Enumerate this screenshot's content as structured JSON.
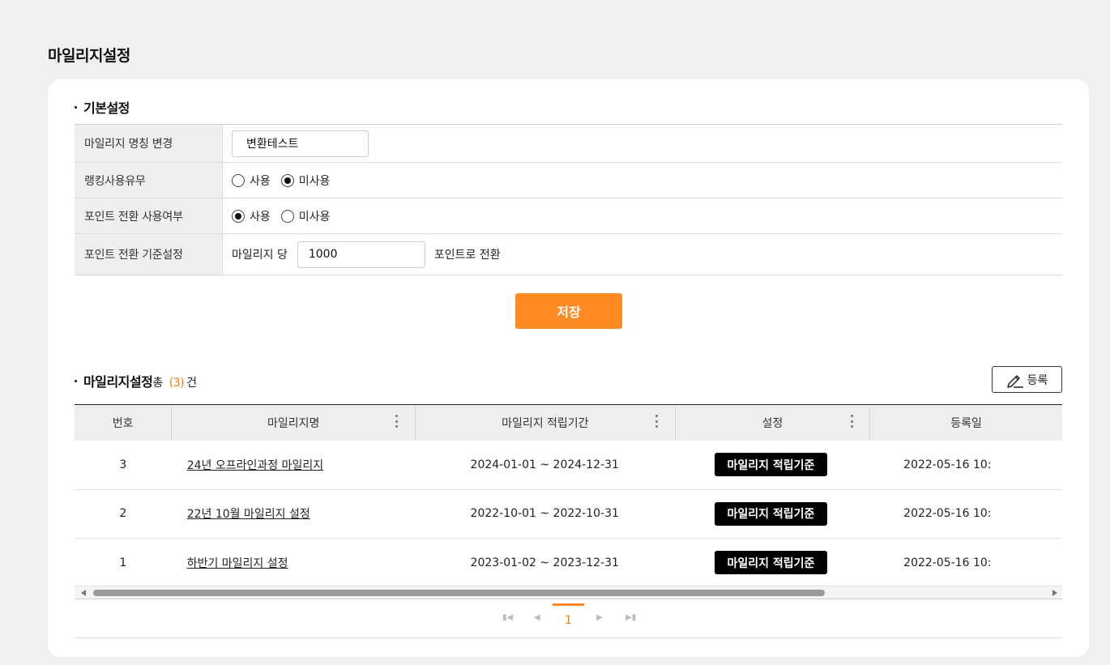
{
  "page_title": "마일리지설정",
  "basic": {
    "title": "기본설정",
    "rows": {
      "name_label": "마일리지 명칭 변경",
      "name_value": "변환테스트",
      "ranking_label": "랭킹사용유무",
      "ranking_options": [
        "사용",
        "미사용"
      ],
      "ranking_selected": "미사용",
      "point_use_label": "포인트 전환 사용여부",
      "point_use_options": [
        "사용",
        "미사용"
      ],
      "point_use_selected": "사용",
      "point_rate_label": "포인트 전환 기준설정",
      "point_rate_prefix": "마일리지 당",
      "point_rate_value": "1000",
      "point_rate_suffix": "포인트로 전환"
    },
    "save_label": "저장"
  },
  "list": {
    "title": "마일리지설정",
    "count_prefix": "총",
    "count_value": "(3)",
    "count_suffix": "건",
    "register_label": "등록",
    "columns": [
      "번호",
      "마일리지명",
      "마일리지 적립기간",
      "설정",
      "등록일"
    ],
    "rows": [
      {
        "no": "3",
        "name": "24년 오프라인과정 마일리지",
        "period": "2024-01-01 ~ 2024-12-31",
        "action": "마일리지 적립기준",
        "date": "2022-05-16 10:"
      },
      {
        "no": "2",
        "name": "22년 10월 마일리지 설정",
        "period": "2022-10-01 ~ 2022-10-31",
        "action": "마일리지 적립기준",
        "date": "2022-05-16 10:"
      },
      {
        "no": "1",
        "name": "하반기 마일리지 설정",
        "period": "2023-01-02 ~ 2023-12-31",
        "action": "마일리지 적립기준",
        "date": "2022-05-16 10:"
      }
    ]
  },
  "pager": {
    "current": "1",
    "first_icon": "first-page-icon",
    "prev_icon": "prev-page-icon",
    "next_icon": "next-page-icon",
    "last_icon": "last-page-icon"
  },
  "colors": {
    "accent": "#ff8a24",
    "count": "#ff7a00",
    "tag_button": "#000000"
  }
}
